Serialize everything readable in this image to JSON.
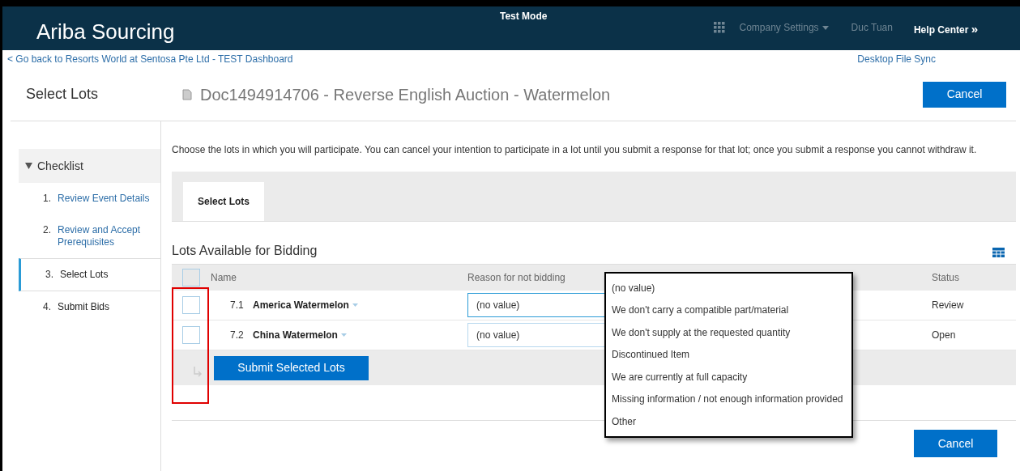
{
  "header": {
    "app_title": "Ariba Sourcing",
    "mode": "Test Mode",
    "company_settings": "Company Settings",
    "user": "Duc Tuan",
    "help": "Help Center",
    "help_chevron": "»"
  },
  "nav": {
    "back_link": "< Go back to Resorts World at Sentosa Pte Ltd - TEST Dashboard",
    "desktop_sync": "Desktop File Sync"
  },
  "page": {
    "title": "Select Lots",
    "document_title": "Doc1494914706 - Reverse English Auction - Watermelon",
    "cancel": "Cancel"
  },
  "checklist": {
    "title": "Checklist",
    "expanded": true,
    "items": [
      {
        "number": "1.",
        "label": "Review Event Details",
        "kind": "link",
        "selected": false
      },
      {
        "number": "2.",
        "label": "Review and Accept Prerequisites",
        "kind": "link",
        "selected": false
      },
      {
        "number": "3.",
        "label": "Select Lots",
        "kind": "plain",
        "selected": true
      },
      {
        "number": "4.",
        "label": "Submit Bids",
        "kind": "plain",
        "selected": false
      }
    ]
  },
  "instructions": "Choose the lots in which you will participate.  You can cancel your intention to participate in a lot until you submit a response for that lot;  once you submit a response you cannot withdraw it.",
  "tabs": [
    {
      "label": "Select Lots",
      "selected": true
    }
  ],
  "section_title": "Lots Available for Bidding",
  "table": {
    "select_all_checked": false,
    "columns": [
      "Name",
      "Reason for not bidding",
      "Status"
    ],
    "rows": [
      {
        "number": "7.1",
        "name": "America Watermelon",
        "reason": "(no value)",
        "focused": true,
        "status": "Review",
        "checked": false
      },
      {
        "number": "7.2",
        "name": "China Watermelon",
        "reason": "(no value)",
        "focused": false,
        "status": "Open",
        "checked": false
      }
    ]
  },
  "submit_button": "Submit Selected Lots",
  "dropdown_options": [
    "(no value)",
    "We don't carry a compatible part/material",
    "We don't supply at the requested quantity",
    "Discontinued Item",
    "We are currently at full capacity",
    "Missing information / not enough information provided",
    "Other"
  ],
  "footer_cancel": "Cancel"
}
